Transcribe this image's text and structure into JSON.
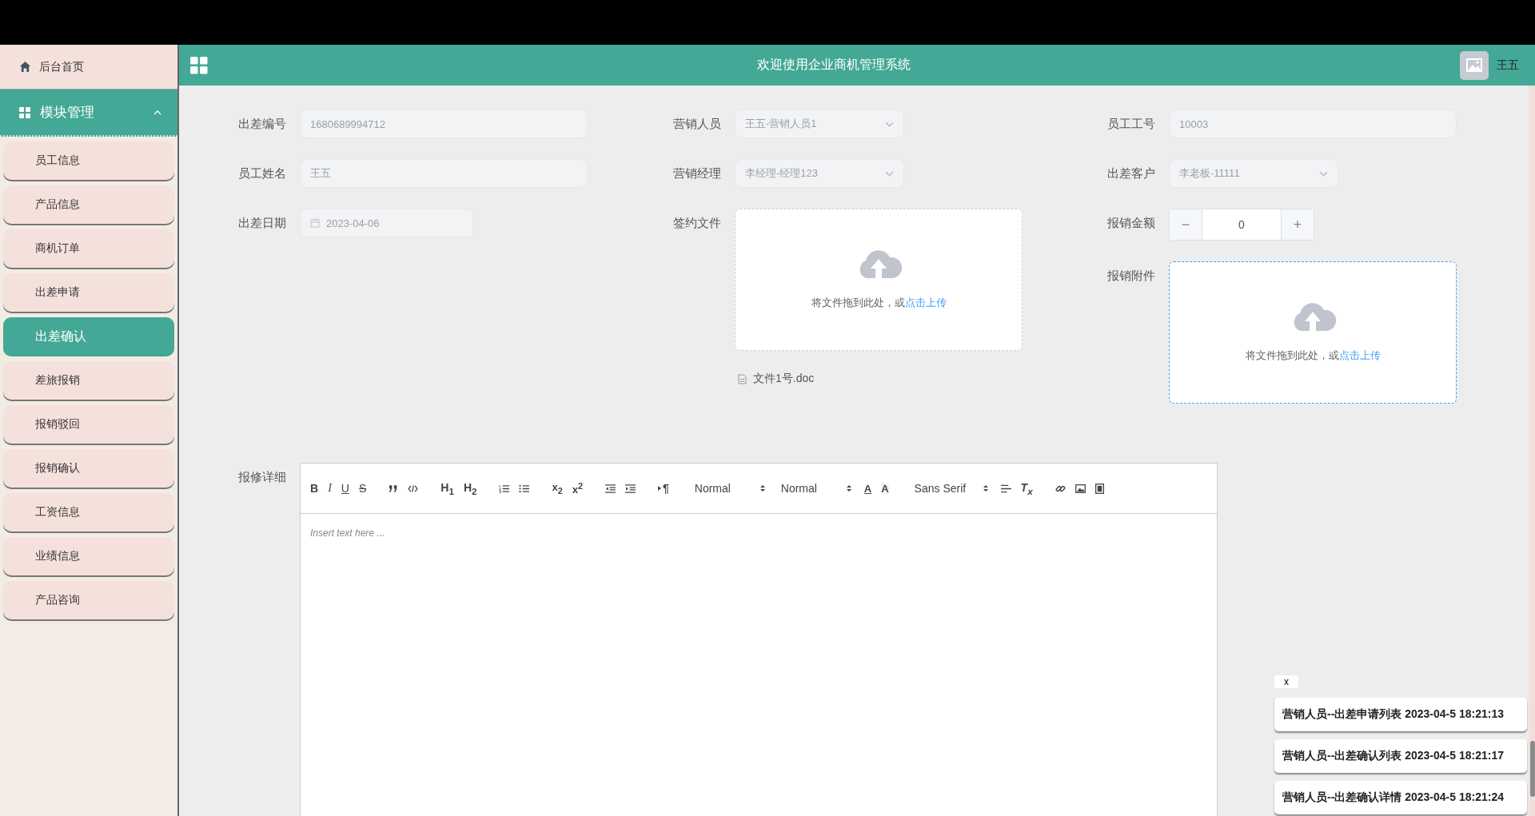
{
  "header": {
    "title": "欢迎使用企业商机管理系统",
    "user": "王五"
  },
  "sidebar": {
    "home": "后台首页",
    "module": {
      "label": "模块管理",
      "expanded": true
    },
    "items": [
      {
        "label": "员工信息",
        "selected": false
      },
      {
        "label": "产品信息",
        "selected": false
      },
      {
        "label": "商机订单",
        "selected": false
      },
      {
        "label": "出差申请",
        "selected": false
      },
      {
        "label": "出差确认",
        "selected": true
      },
      {
        "label": "差旅报销",
        "selected": false
      },
      {
        "label": "报销驳回",
        "selected": false
      },
      {
        "label": "报销确认",
        "selected": false
      },
      {
        "label": "工资信息",
        "selected": false
      },
      {
        "label": "业绩信息",
        "selected": false
      },
      {
        "label": "产品咨询",
        "selected": false
      }
    ]
  },
  "form": {
    "columns": [
      [
        {
          "kind": "input",
          "label": "出差编号",
          "value": "1680689994712"
        },
        {
          "kind": "input",
          "label": "员工姓名",
          "value": "王五"
        },
        {
          "kind": "date",
          "label": "出差日期",
          "value": "2023-04-06"
        }
      ],
      [
        {
          "kind": "select",
          "label": "营销人员",
          "value": "王五-营销人员1"
        },
        {
          "kind": "select",
          "label": "营销经理",
          "value": "李经理-经理123"
        },
        {
          "kind": "upload",
          "label": "签约文件",
          "hint": "将文件拖到此处，或",
          "link": "点击上传",
          "highlighted": false,
          "file": "文件1号.doc"
        }
      ],
      [
        {
          "kind": "input",
          "label": "员工工号",
          "value": "10003"
        },
        {
          "kind": "select",
          "label": "出差客户",
          "value": "李老板-11111"
        },
        {
          "kind": "number",
          "label": "报销金额",
          "value": "0",
          "minus": "−",
          "plus": "+"
        },
        {
          "kind": "upload",
          "label": "报销附件",
          "hint": "将文件拖到此处，或",
          "link": "点击上传",
          "highlighted": true
        }
      ]
    ]
  },
  "editor": {
    "label": "报修详细",
    "marks": [
      "B",
      "I",
      "U",
      "S"
    ],
    "headers": [
      "H$_{1}$",
      "H$_{2}$"
    ],
    "scripts": [
      "x$_{2}$",
      "x$^{2}$"
    ],
    "direction": "¶",
    "pickers": [
      "Normal",
      "Normal"
    ],
    "colors": [
      "A",
      "A"
    ],
    "font": "Sans Serif",
    "clean": "T$_{x}$",
    "placeholder": "Insert text here ..."
  },
  "notifications": {
    "close": "x",
    "items": [
      "营销人员--出差申请列表 2023-04-5 18:21:13",
      "营销人员--出差确认列表 2023-04-5 18:21:17",
      "营销人员--出差确认详情 2023-04-5 18:21:24"
    ]
  }
}
